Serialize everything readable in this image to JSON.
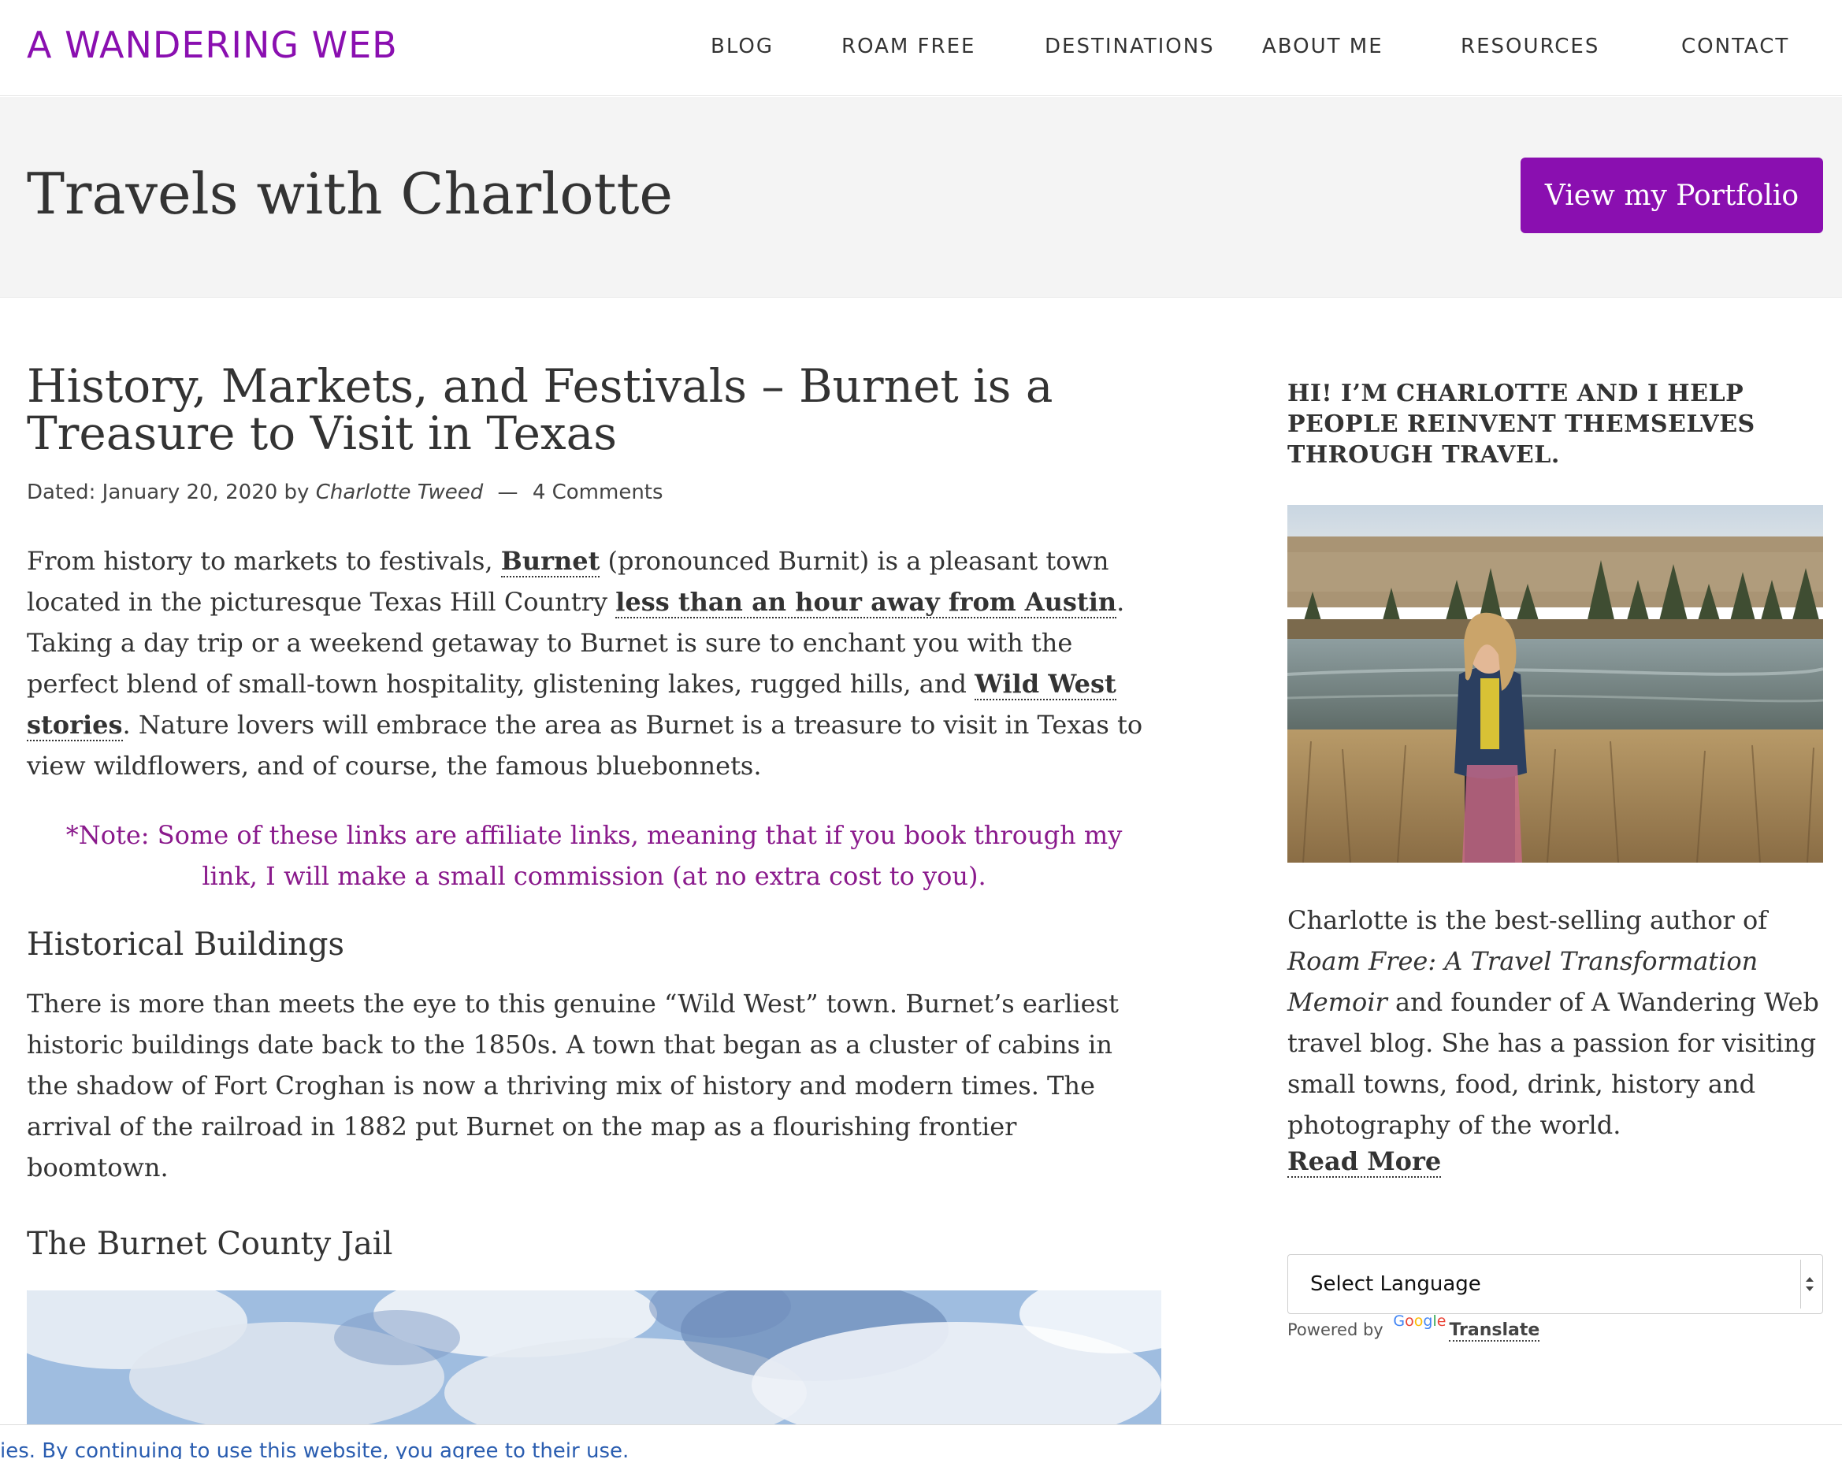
{
  "header": {
    "site_title": "A WANDERING WEB",
    "nav": [
      "BLOG",
      "ROAM FREE",
      "DESTINATIONS",
      "ABOUT ME",
      "RESOURCES",
      "CONTACT"
    ]
  },
  "hero": {
    "title": "Travels with Charlotte",
    "button_label": "View my Portfolio"
  },
  "article": {
    "title": "History, Markets, and Festivals – Burnet is a Treasure to Visit in Texas",
    "meta": {
      "dated_label": "Dated: January 20, 2020 by",
      "author": "Charlotte Tweed",
      "separator": "—",
      "comments": "4 Comments"
    },
    "intro": {
      "t1": "From history to markets to festivals, ",
      "link1": "Burnet",
      "t2": " (pronounced Burnit) is a pleasant town located in the picturesque Texas Hill Country ",
      "link2": "less than an hour away from Austin",
      "t3": ". Taking a day trip or a weekend getaway to Burnet is sure to enchant you with the perfect blend of small-town hospitality, glistening lakes, rugged hills, and ",
      "link3": "Wild West stories",
      "t4": ". Nature lovers will embrace the area as Burnet is a treasure to visit in Texas to view wildflowers, and of course, the famous bluebonnets."
    },
    "note": "*Note: Some of these links are affiliate links, meaning that if you book through my link, I will make a small commission (at no extra cost to you).",
    "section1_heading": "Historical Buildings",
    "section1_text": "There is more than meets the eye to this genuine “Wild West” town. Burnet’s earliest historic buildings date back to the 1850s. A town that began as a cluster of cabins in the shadow of Fort Croghan is now a thriving mix of history and modern times. The arrival of the railroad in 1882 put Burnet on the map as a flourishing frontier boomtown.",
    "section2_heading": "The Burnet County Jail"
  },
  "sidebar": {
    "widget_title": "HI! I’M CHARLOTTE AND I HELP PEOPLE REINVENT THEMSELVES THROUGH TRAVEL.",
    "bio": {
      "t1": "Charlotte is the best-selling author of ",
      "book": "Roam Free: A Travel Transformation Memoir",
      "t2": " and founder of A Wandering Web travel blog. She has a passion for visiting small towns, food, drink, history and photography of the world."
    },
    "read_more": "Read More",
    "language_select": "Select Language",
    "powered_by": "Powered by",
    "google": "Google",
    "translate": "Translate"
  },
  "cookie_bar": {
    "text": "ies. By continuing to use this website, you agree to their use."
  },
  "colors": {
    "brand_purple": "#8a0fb0",
    "note_purple": "#8a1a8c",
    "hero_bg": "#f4f4f4"
  }
}
